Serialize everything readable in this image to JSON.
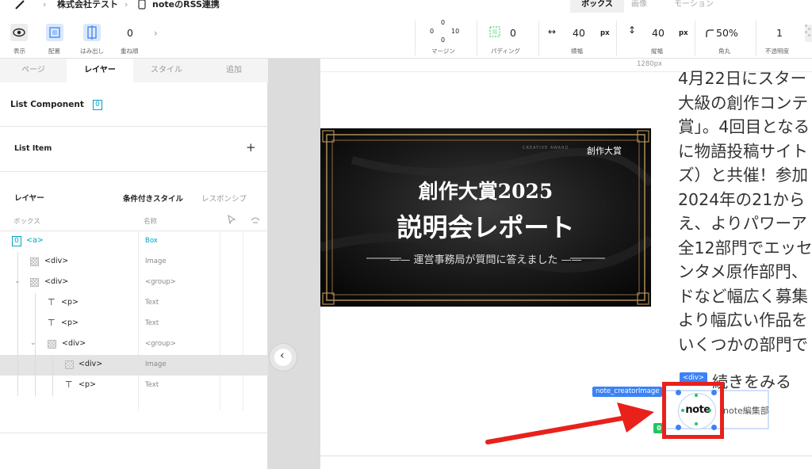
{
  "header": {
    "breadcrumb": [
      "株式会社テスト",
      "noteのRSS連携"
    ],
    "right_tabs": [
      "ボックス",
      "画像",
      "モーション"
    ],
    "active_tab": "ボックス"
  },
  "toolbar": {
    "display_label": "表示",
    "layout_label": "配置",
    "overflow_label": "はみ出し",
    "zindex_value": "0",
    "zindex_label": "重ね順",
    "margin": {
      "top": "0",
      "right": "10",
      "bottom": "0",
      "left": "0",
      "label": "マージン"
    },
    "padding": {
      "value": "0",
      "label": "パディング"
    },
    "width": {
      "value": "40",
      "unit": "px",
      "label": "横幅"
    },
    "height": {
      "value": "40",
      "unit": "px",
      "label": "縦幅"
    },
    "radius": {
      "value": "50%",
      "label": "角丸"
    },
    "opacity": {
      "value": "1",
      "label": "不透明度"
    }
  },
  "left_panel": {
    "tabs": [
      "ページ",
      "レイヤー",
      "スタイル",
      "追加"
    ],
    "active_tab": "レイヤー",
    "component_title": "List Component",
    "component_badge": "0",
    "list_item_label": "List Item",
    "add_symbol": "+",
    "layer_header": "レイヤー",
    "conditional_style": "条件付きスタイル",
    "responsive": "レスポンシブ",
    "col_box": "ボックス",
    "col_name": "名称",
    "tree": [
      {
        "badge": "0",
        "tag": "<a>",
        "type": "Box",
        "icon": "none"
      },
      {
        "tag": "<div>",
        "type": "Image",
        "icon": "image-icon"
      },
      {
        "tag": "<div>",
        "type": "<group>",
        "icon": "image-icon"
      },
      {
        "tag": "<p>",
        "type": "Text",
        "icon": "text-icon"
      },
      {
        "tag": "<p>",
        "type": "Text",
        "icon": "text-icon"
      },
      {
        "tag": "<div>",
        "type": "<group>",
        "icon": "image-icon"
      },
      {
        "tag": "<div>",
        "type": "Image",
        "icon": "image-icon"
      },
      {
        "tag": "<p>",
        "type": "Text",
        "icon": "text-icon"
      }
    ]
  },
  "canvas": {
    "width_label": "1280px",
    "banner": {
      "corner_label": "創作大賞",
      "small_caption": "CREATIVE AWARD",
      "title1": "創作大賞2025",
      "title2": "説明会レポート",
      "subtitle": "運営事務局が質問に答えました"
    },
    "article_lines": [
      "4月22日にスター",
      "大級の創作コンテ",
      "賞」。4回目となる",
      "に物語投稿サイト",
      "ズ）と共催！参加",
      "2024年の21から",
      "え、よりパワーア",
      "全12部門でエッセ",
      "ンタメ原作部門、",
      "ドなど幅広く募集",
      "より幅広い作品を",
      "いくつかの部門で"
    ],
    "read_more": "続きをみる",
    "div_tag": "<div>",
    "creator_image_tag": "note_creatorImage",
    "creator_name": "note編集部",
    "logo_text": "note",
    "zero_badge": "0",
    "collapse_icon": "chevron-left-icon"
  },
  "colors": {
    "accent_blue": "#3b82f6",
    "selection_green": "#22c55e",
    "highlight_red": "#e8211b",
    "arrow_red": "#e8211b",
    "teal": "#00a3c4",
    "banner_gold": "#b08d57"
  }
}
